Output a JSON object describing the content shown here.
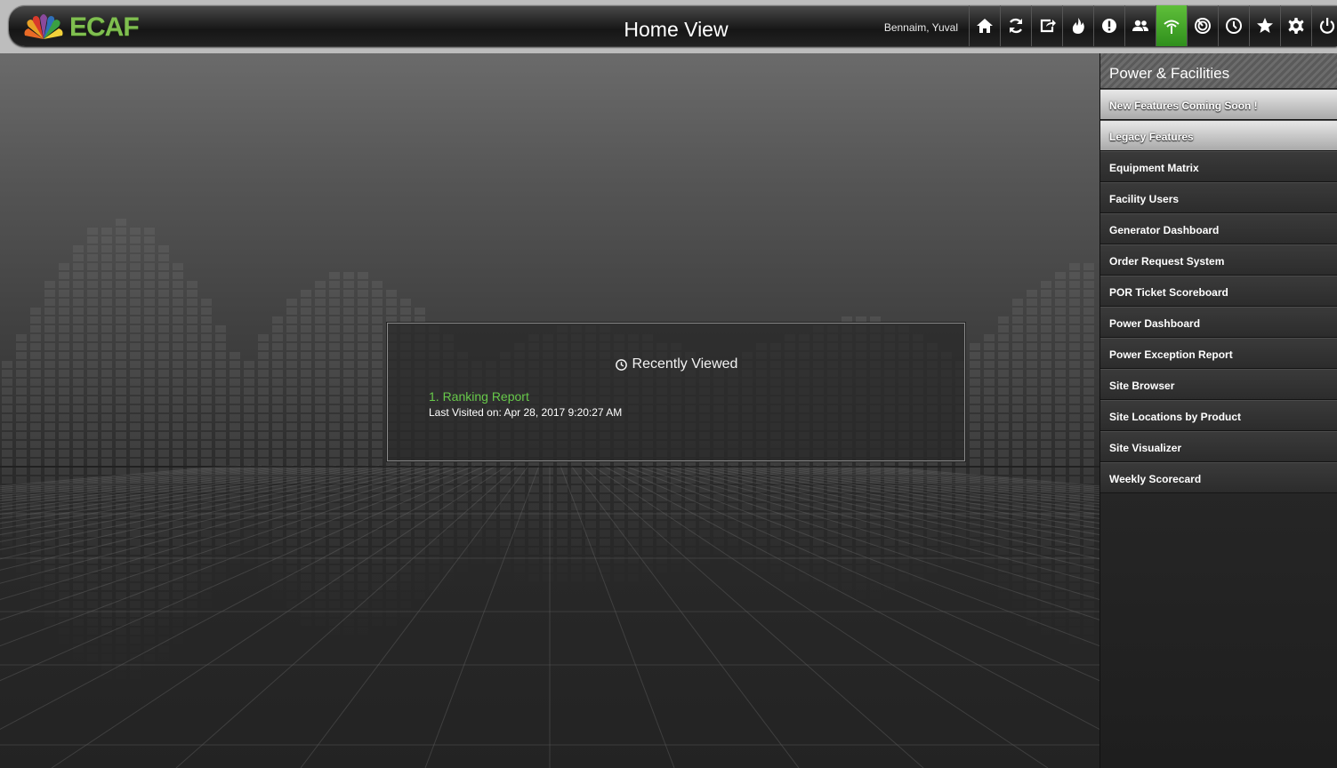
{
  "header": {
    "logo_text": "ECAF",
    "title": "Home View",
    "user": "Bennaim, Yuval",
    "toolbar": [
      {
        "icon": "home-icon"
      },
      {
        "icon": "refresh-icon"
      },
      {
        "icon": "share-icon"
      },
      {
        "icon": "fire-icon"
      },
      {
        "icon": "alert-icon"
      },
      {
        "icon": "users-icon"
      },
      {
        "icon": "signal-icon",
        "active": true
      },
      {
        "icon": "radar-icon"
      },
      {
        "icon": "clock-icon"
      },
      {
        "icon": "star-icon"
      },
      {
        "icon": "gear-icon"
      },
      {
        "icon": "power-icon"
      }
    ]
  },
  "recent": {
    "title": "Recently Viewed",
    "items": [
      {
        "label": "1. Ranking Report",
        "visited": "Last Visited on: Apr 28, 2017 9:20:27 AM"
      }
    ]
  },
  "sidebar": {
    "title": "Power & Facilities",
    "items": [
      {
        "label": "New Features Coming Soon !",
        "style": "light"
      },
      {
        "label": "Legacy Features",
        "style": "light"
      },
      {
        "label": "Equipment Matrix"
      },
      {
        "label": "Facility Users"
      },
      {
        "label": "Generator Dashboard"
      },
      {
        "label": "Order Request System"
      },
      {
        "label": "POR Ticket Scoreboard"
      },
      {
        "label": "Power Dashboard"
      },
      {
        "label": "Power Exception Report"
      },
      {
        "label": "Site Browser"
      },
      {
        "label": "Site Locations by Product"
      },
      {
        "label": "Site Visualizer"
      },
      {
        "label": "Weekly Scorecard"
      }
    ]
  },
  "colors": {
    "accent_green": "#67c94a",
    "logo_green": "#7fbf4f",
    "active_button": "#4caf30"
  }
}
